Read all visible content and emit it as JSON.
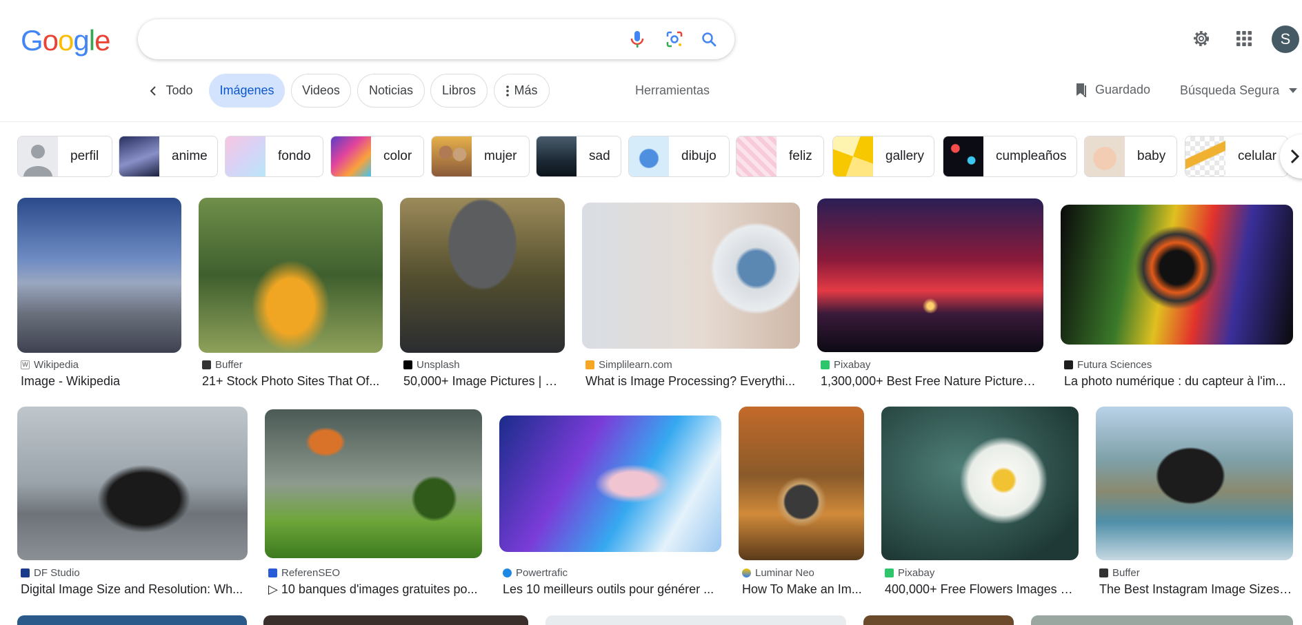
{
  "header": {
    "logo_letters": [
      {
        "ch": "G",
        "color": "#4285F4"
      },
      {
        "ch": "o",
        "color": "#EA4335"
      },
      {
        "ch": "o",
        "color": "#FBBC05"
      },
      {
        "ch": "g",
        "color": "#4285F4"
      },
      {
        "ch": "l",
        "color": "#34A853"
      },
      {
        "ch": "e",
        "color": "#EA4335"
      }
    ],
    "search_value": "",
    "icons": [
      "mic-icon",
      "lens-icon",
      "search-icon",
      "settings-gear-icon",
      "apps-grid-icon"
    ],
    "avatar_letter": "S"
  },
  "tabs": {
    "back_label": "Todo",
    "items": [
      "Imágenes",
      "Videos",
      "Noticias",
      "Libros",
      "Más"
    ],
    "active": "Imágenes",
    "tools": "Herramientas",
    "saved": "Guardado",
    "safe_search": "Búsqueda Segura"
  },
  "chips": [
    "perfil",
    "anime",
    "fondo",
    "color",
    "mujer",
    "sad",
    "dibujo",
    "feliz",
    "gallery",
    "cumpleaños",
    "baby",
    "celular"
  ],
  "results": [
    {
      "source": "Wikipedia",
      "title": "Image - Wikipedia"
    },
    {
      "source": "Buffer",
      "title": "21+ Stock Photo Sites That Of..."
    },
    {
      "source": "Unsplash",
      "title": "50,000+ Image Pictures | D..."
    },
    {
      "source": "Simplilearn.com",
      "title": "What is Image Processing? Everythi..."
    },
    {
      "source": "Pixabay",
      "title": "1,300,000+ Best Free Nature Pictures ..."
    },
    {
      "source": "Futura Sciences",
      "title": "La photo numérique : du capteur à l'im..."
    },
    {
      "source": "DF Studio",
      "title": "Digital Image Size and Resolution: Wh..."
    },
    {
      "source": "ReferenSEO",
      "title": "▷ 10 banques d'images gratuites po..."
    },
    {
      "source": "Powertrafic",
      "title": "Les 10 meilleurs outils pour générer ..."
    },
    {
      "source": "Luminar Neo",
      "title": "How To Make an Im..."
    },
    {
      "source": "Pixabay",
      "title": "400,000+ Free Flowers Images &..."
    },
    {
      "source": "Buffer",
      "title": "The Best Instagram Image Sizes:..."
    }
  ],
  "colors": {
    "accent": "#0b57d0",
    "active_tab_bg": "#d3e3fd"
  }
}
